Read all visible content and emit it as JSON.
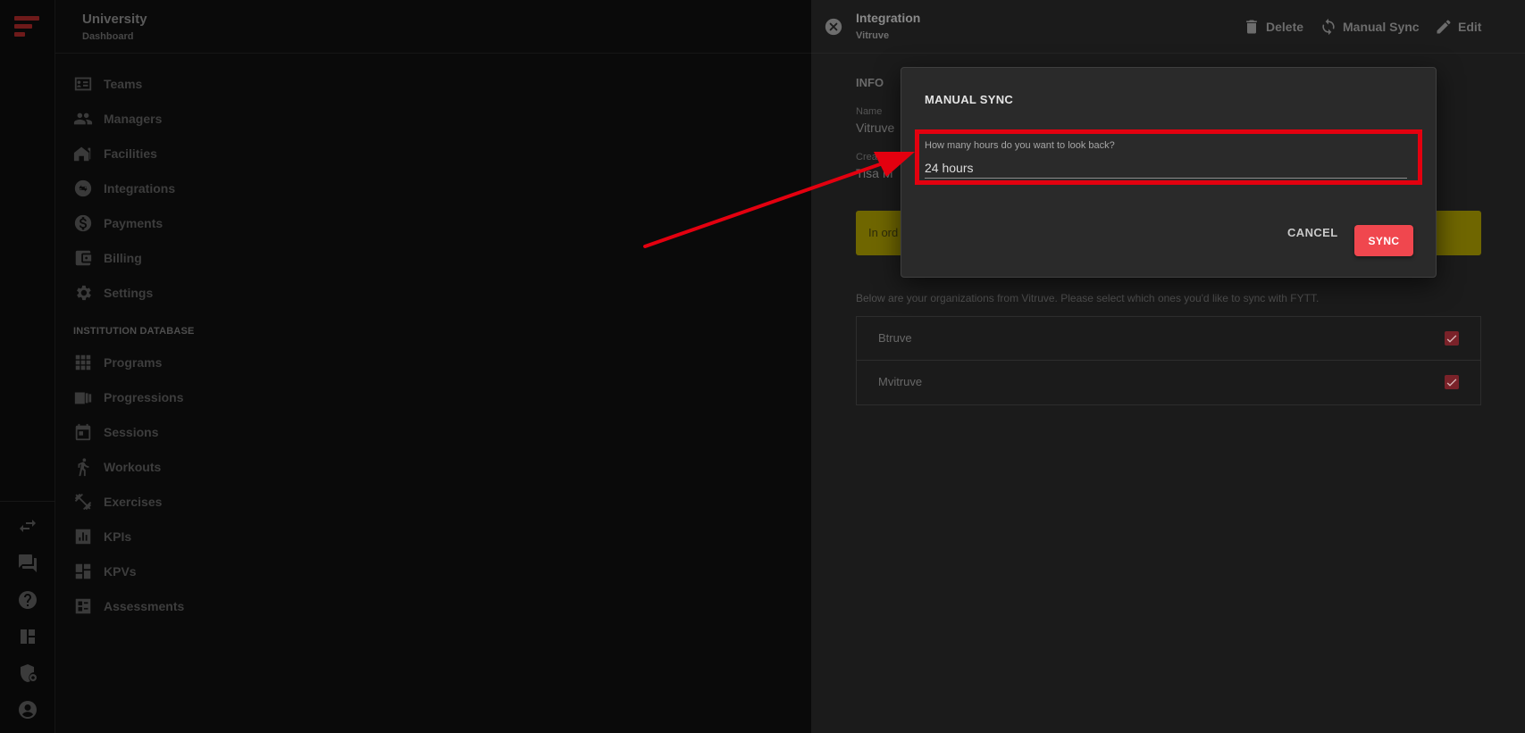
{
  "sidebar": {
    "title": "University",
    "subtitle": "Dashboard",
    "items": [
      {
        "label": "Teams",
        "icon": "contacts-icon"
      },
      {
        "label": "Managers",
        "icon": "people-icon"
      },
      {
        "label": "Facilities",
        "icon": "home-icon"
      },
      {
        "label": "Integrations",
        "icon": "sync-icon"
      },
      {
        "label": "Payments",
        "icon": "dollar-icon"
      },
      {
        "label": "Billing",
        "icon": "wallet-icon"
      },
      {
        "label": "Settings",
        "icon": "gear-icon"
      }
    ],
    "section_label": "INSTITUTION DATABASE",
    "db_items": [
      {
        "label": "Programs",
        "icon": "grid-icon"
      },
      {
        "label": "Progressions",
        "icon": "progression-icon"
      },
      {
        "label": "Sessions",
        "icon": "calendar-icon"
      },
      {
        "label": "Workouts",
        "icon": "run-icon"
      },
      {
        "label": "Exercises",
        "icon": "dumbbell-icon"
      },
      {
        "label": "KPIs",
        "icon": "bar-chart-icon"
      },
      {
        "label": "KPVs",
        "icon": "dashboard-icon"
      },
      {
        "label": "Assessments",
        "icon": "assessment-icon"
      }
    ]
  },
  "panel": {
    "title": "Integration",
    "subtitle": "Vitruve",
    "actions": {
      "delete": "Delete",
      "manual_sync": "Manual Sync",
      "edit": "Edit"
    },
    "info_heading": "INFO",
    "name_label": "Name",
    "name_value": "Vitruve",
    "created_label": "Create",
    "created_value": "Tisa M",
    "notice_text": "In ord",
    "orgs_intro": "Below are your organizations from Vitruve. Please select which ones you'd like to sync with FYTT.",
    "orgs": [
      {
        "name": "Btruve",
        "checked": true
      },
      {
        "name": "Mvitruve",
        "checked": true
      }
    ]
  },
  "modal": {
    "title": "MANUAL SYNC",
    "input_label": "How many hours do you want to look back?",
    "input_value": "24 hours",
    "cancel_label": "CANCEL",
    "sync_label": "SYNC"
  },
  "colors": {
    "accent": "#f0474e",
    "highlight": "#e3000f",
    "notice": "#6f6600"
  }
}
